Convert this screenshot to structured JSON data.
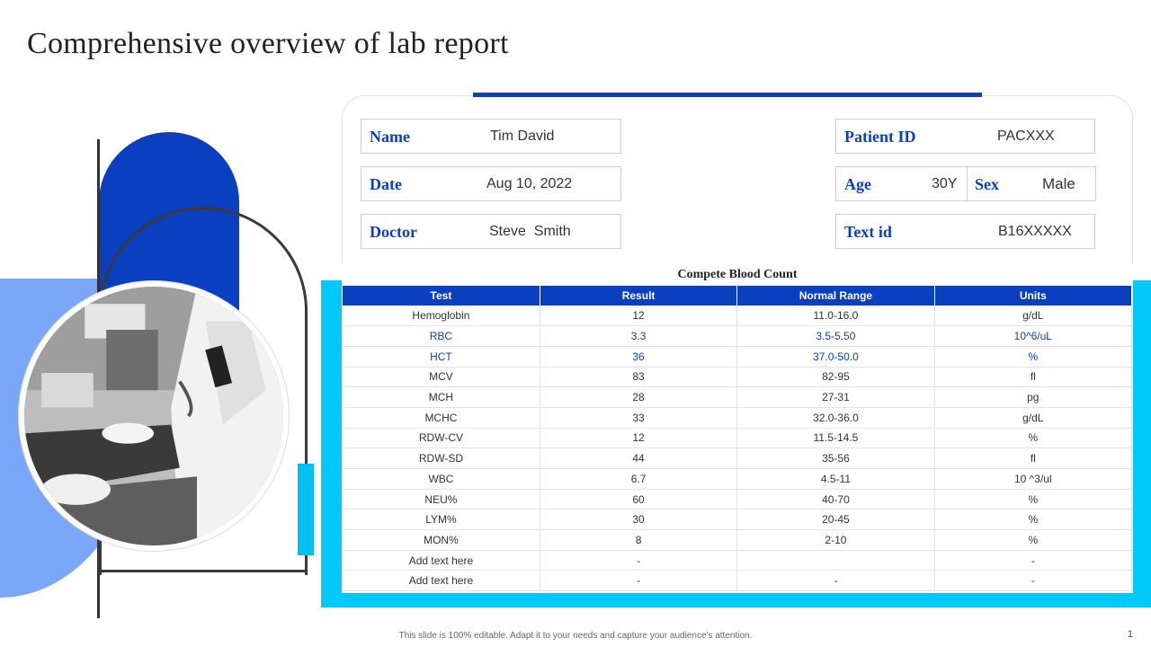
{
  "slide": {
    "title": "Comprehensive overview of lab report",
    "footer": "This slide is 100% editable. Adapt it to your needs and capture your audience's attention.",
    "page_number": "1"
  },
  "patient": {
    "name_label": "Name",
    "name_value": "Tim David",
    "date_label": "Date",
    "date_value": "Aug 10, 2022",
    "doctor_label": "Doctor",
    "doctor_value": "Steve  Smith",
    "patient_id_label": "Patient ID",
    "patient_id_value": "PACXXX",
    "age_label": "Age",
    "age_value": "30Y",
    "sex_label": "Sex",
    "sex_value": "Male",
    "text_id_label": "Text id",
    "text_id_value": "B16XXXXX"
  },
  "table": {
    "title": "Compete Blood Count",
    "headers": [
      "Test",
      "Result",
      "Normal Range",
      "Units"
    ],
    "rows": [
      {
        "test": "Hemoglobin",
        "result": "12",
        "range": "11.0-16.0",
        "units": "g/dL",
        "highlight": false
      },
      {
        "test": "RBC",
        "result": "3.3",
        "range": "3.5-5.50",
        "units": "10^6/uL",
        "highlight": true
      },
      {
        "test": "HCT",
        "result": "36",
        "range": "37.0-50.0",
        "units": "%",
        "highlight": true
      },
      {
        "test": "MCV",
        "result": "83",
        "range": "82-95",
        "units": "fl",
        "highlight": false
      },
      {
        "test": "MCH",
        "result": "28",
        "range": "27-31",
        "units": "pg",
        "highlight": false
      },
      {
        "test": "MCHC",
        "result": "33",
        "range": "32.0-36.0",
        "units": "g/dL",
        "highlight": false
      },
      {
        "test": "RDW-CV",
        "result": "12",
        "range": "11.5-14.5",
        "units": "%",
        "highlight": false
      },
      {
        "test": "RDW-SD",
        "result": "44",
        "range": "35-56",
        "units": "fl",
        "highlight": false
      },
      {
        "test": "WBC",
        "result": "6.7",
        "range": "4.5-11",
        "units": "10 ^3/ul",
        "highlight": false
      },
      {
        "test": "NEU%",
        "result": "60",
        "range": "40-70",
        "units": "%",
        "highlight": false
      },
      {
        "test": "LYM%",
        "result": "30",
        "range": "20-45",
        "units": "%",
        "highlight": false
      },
      {
        "test": "MON%",
        "result": "8",
        "range": "2-10",
        "units": "%",
        "highlight": false
      },
      {
        "test": "Add text here",
        "result": "-",
        "range": "",
        "units": "-",
        "highlight": false
      },
      {
        "test": "Add text here",
        "result": "-",
        "range": "-",
        "units": "-",
        "highlight": false
      }
    ]
  },
  "colors": {
    "primary_blue": "#0a3fbf",
    "cyan": "#00c8f8",
    "light_blue": "#7aa7f7"
  }
}
